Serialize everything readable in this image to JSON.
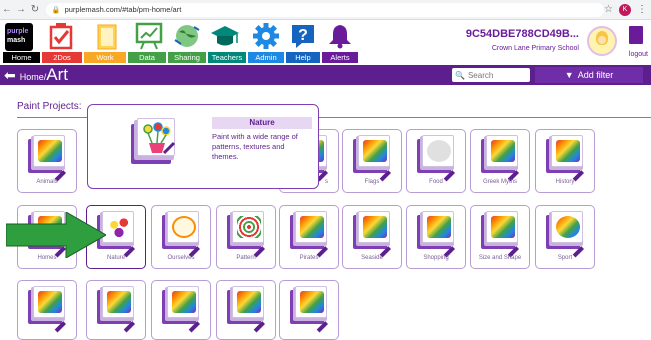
{
  "browser": {
    "url": "purplemash.com/#tab/pm-home/art",
    "profile_initial": "K"
  },
  "toolbar": {
    "logo_line1": "purple",
    "logo_line2": "mash",
    "items": [
      {
        "label": "Home",
        "icon": "purplemash-logo",
        "color": "#000000"
      },
      {
        "label": "2Dos",
        "icon": "checklist-icon",
        "color": "#e53935"
      },
      {
        "label": "Work",
        "icon": "folder-icon",
        "color": "#f9a825"
      },
      {
        "label": "Data",
        "icon": "chart-board-icon",
        "color": "#43a047"
      },
      {
        "label": "Sharing",
        "icon": "globe-icon",
        "color": "#43a047"
      },
      {
        "label": "Teachers",
        "icon": "graduation-cap-icon",
        "color": "#00897b"
      },
      {
        "label": "Admin",
        "icon": "gear-icon",
        "color": "#1e88e5"
      },
      {
        "label": "Help",
        "icon": "question-icon",
        "color": "#1e88e5"
      },
      {
        "label": "Alerts",
        "icon": "bell-icon",
        "color": "#6a1b9a"
      }
    ],
    "school_id": "9C54DBE788CD49B...",
    "school_name": "Crown Lane Primary School",
    "logout_label": "logout"
  },
  "nav": {
    "home_label": "Home/",
    "current_label": "Art",
    "search_placeholder": "Search",
    "add_filter_label": "Add filter"
  },
  "section_title": "Paint Projects:",
  "tooltip": {
    "title": "Nature",
    "description": "Paint with a wide range of patterns, textures and themes."
  },
  "projects_row1": [
    {
      "label": "Animals"
    },
    {
      "label": ""
    },
    {
      "label": ""
    },
    {
      "label": ""
    },
    {
      "label": "s"
    },
    {
      "label": "Flags"
    },
    {
      "label": "Food"
    },
    {
      "label": "Greek Myths"
    },
    {
      "label": "History"
    }
  ],
  "projects_row2": [
    {
      "label": "Homes"
    },
    {
      "label": "Nature"
    },
    {
      "label": "Ourselves"
    },
    {
      "label": "Pattern"
    },
    {
      "label": "Pirates"
    },
    {
      "label": "Seaside"
    },
    {
      "label": "Shopping"
    },
    {
      "label": "Size and Shape"
    },
    {
      "label": "Sport"
    }
  ],
  "projects_row3": [
    {
      "label": ""
    },
    {
      "label": ""
    },
    {
      "label": ""
    },
    {
      "label": ""
    },
    {
      "label": ""
    }
  ],
  "colors": {
    "brand_purple": "#5e1f8e",
    "card_border": "#b79dd3",
    "arrow_green": "#2e9e3f"
  }
}
